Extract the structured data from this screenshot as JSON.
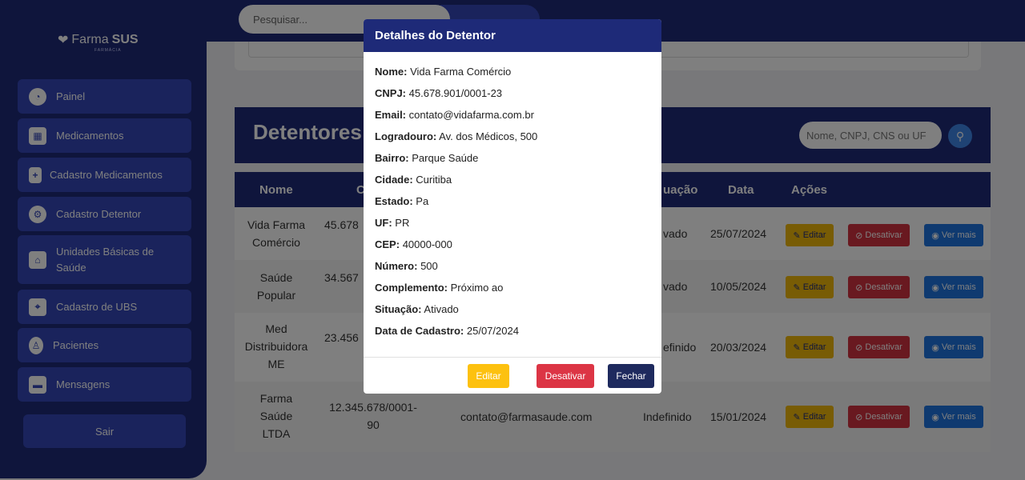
{
  "app": {
    "logo_text": "Farma",
    "logo_bold": "SUS",
    "logo_sub": "FARMÁCIA"
  },
  "sidebar": {
    "items": [
      {
        "label": "Painel",
        "icon": "dashboard-icon"
      },
      {
        "label": "Medicamentos",
        "icon": "boxes-icon"
      },
      {
        "label": "Cadastro Medicamentos",
        "icon": "medicine-box-icon"
      },
      {
        "label": "Cadastro Detentor",
        "icon": "users-gear-icon"
      },
      {
        "label": "Unidades Básicas de Saúde",
        "icon": "hospital-house-icon"
      },
      {
        "label": "Cadastro de UBS",
        "icon": "map-pin-icon"
      },
      {
        "label": "Pacientes",
        "icon": "patient-icon"
      },
      {
        "label": "Mensagens",
        "icon": "chat-icon"
      }
    ],
    "logout_label": "Sair"
  },
  "topbar": {
    "search_placeholder": "Pesquisar..."
  },
  "main": {
    "title": "Detentores",
    "filter_placeholder": "Nome, CNPJ, CNS ou UF",
    "columns": [
      "Nome",
      "C",
      "uação",
      "Data",
      "Ações"
    ],
    "rows": [
      {
        "nome": "Vida Farma Comércio",
        "cnpj": "45.678",
        "email": "",
        "situacao": "vado",
        "data": "25/07/2024"
      },
      {
        "nome": "Saúde Popular",
        "cnpj": "34.567",
        "email": "",
        "situacao": "vado",
        "data": "10/05/2024"
      },
      {
        "nome": "Med Distribuidora ME",
        "cnpj": "23.456",
        "email": "",
        "situacao": "efinido",
        "data": "20/03/2024"
      },
      {
        "nome": "Farma Saúde LTDA",
        "cnpj": "12.345.678/0001-90",
        "email": "contato@farmasaude.com",
        "situacao": "Indefinido",
        "data": "15/01/2024"
      }
    ],
    "actions": {
      "edit": "Editar",
      "deactivate": "Desativar",
      "view": "Ver mais"
    }
  },
  "modal": {
    "title": "Detalhes do Detentor",
    "fields": [
      {
        "label": "Nome:",
        "value": "Vida Farma Comércio"
      },
      {
        "label": "CNPJ:",
        "value": "45.678.901/0001-23"
      },
      {
        "label": "Email:",
        "value": "contato@vidafarma.com.br"
      },
      {
        "label": "Logradouro:",
        "value": "Av. dos Médicos, 500"
      },
      {
        "label": "Bairro:",
        "value": "Parque Saúde"
      },
      {
        "label": "Cidade:",
        "value": "Curitiba"
      },
      {
        "label": "Estado:",
        "value": "Pa"
      },
      {
        "label": "UF:",
        "value": "PR"
      },
      {
        "label": "CEP:",
        "value": "40000-000"
      },
      {
        "label": "Número:",
        "value": "500"
      },
      {
        "label": "Complemento:",
        "value": "Próximo ao"
      },
      {
        "label": "Situação:",
        "value": "Ativado"
      },
      {
        "label": "Data de Cadastro:",
        "value": "25/07/2024"
      }
    ],
    "buttons": {
      "edit": "Editar",
      "deactivate": "Desativar",
      "close": "Fechar"
    }
  },
  "colors": {
    "primary": "#1e2a78",
    "nav": "#3547b8",
    "edit": "#f0b90b",
    "danger": "#d23340",
    "info": "#1f74e0"
  }
}
